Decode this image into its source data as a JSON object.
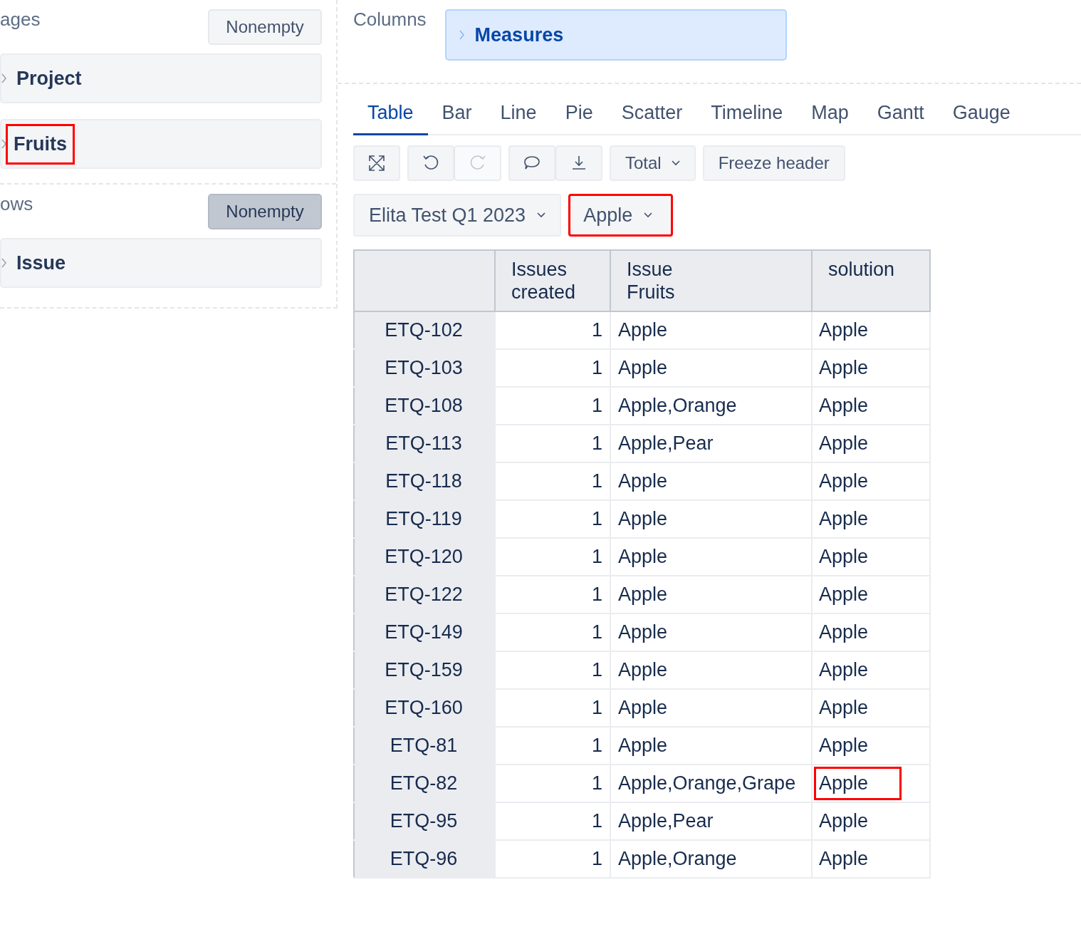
{
  "sections": [
    {
      "title": "ages",
      "nonempty": {
        "label": "Nonempty",
        "selected": false
      },
      "items": [
        {
          "label": "Project",
          "highlighted": false
        },
        {
          "label": "Fruits",
          "highlighted": true
        }
      ]
    },
    {
      "title": "ows",
      "nonempty": {
        "label": "Nonempty",
        "selected": true
      },
      "items": [
        {
          "label": "Issue",
          "highlighted": false
        }
      ]
    }
  ],
  "columns": {
    "title": "Columns",
    "items": [
      {
        "label": "Measures"
      }
    ]
  },
  "tabs": [
    {
      "label": "Table",
      "selected": true
    },
    {
      "label": "Bar",
      "selected": false
    },
    {
      "label": "Line",
      "selected": false
    },
    {
      "label": "Pie",
      "selected": false
    },
    {
      "label": "Scatter",
      "selected": false
    },
    {
      "label": "Timeline",
      "selected": false
    },
    {
      "label": "Map",
      "selected": false
    },
    {
      "label": "Gantt",
      "selected": false
    },
    {
      "label": "Gauge",
      "selected": false
    }
  ],
  "toolbar": {
    "total": "Total",
    "freeze": "Freeze header",
    "redo_disabled": true
  },
  "filters": [
    {
      "label": "Elita Test Q1 2023",
      "highlighted": false
    },
    {
      "label": "Apple",
      "highlighted": true
    }
  ],
  "table": {
    "columns": [
      "Issues\ncreated",
      "Issue\nFruits",
      "solution"
    ],
    "rows": [
      {
        "label": "ETQ-102",
        "issues_created": "1",
        "fruits": "Apple",
        "solution": "Apple",
        "solution_highlighted": false
      },
      {
        "label": "ETQ-103",
        "issues_created": "1",
        "fruits": "Apple",
        "solution": "Apple",
        "solution_highlighted": false
      },
      {
        "label": "ETQ-108",
        "issues_created": "1",
        "fruits": "Apple,Orange",
        "solution": "Apple",
        "solution_highlighted": false
      },
      {
        "label": "ETQ-113",
        "issues_created": "1",
        "fruits": "Apple,Pear",
        "solution": "Apple",
        "solution_highlighted": false
      },
      {
        "label": "ETQ-118",
        "issues_created": "1",
        "fruits": "Apple",
        "solution": "Apple",
        "solution_highlighted": false
      },
      {
        "label": "ETQ-119",
        "issues_created": "1",
        "fruits": "Apple",
        "solution": "Apple",
        "solution_highlighted": false
      },
      {
        "label": "ETQ-120",
        "issues_created": "1",
        "fruits": "Apple",
        "solution": "Apple",
        "solution_highlighted": false
      },
      {
        "label": "ETQ-122",
        "issues_created": "1",
        "fruits": "Apple",
        "solution": "Apple",
        "solution_highlighted": false
      },
      {
        "label": "ETQ-149",
        "issues_created": "1",
        "fruits": "Apple",
        "solution": "Apple",
        "solution_highlighted": false
      },
      {
        "label": "ETQ-159",
        "issues_created": "1",
        "fruits": "Apple",
        "solution": "Apple",
        "solution_highlighted": false
      },
      {
        "label": "ETQ-160",
        "issues_created": "1",
        "fruits": "Apple",
        "solution": "Apple",
        "solution_highlighted": false
      },
      {
        "label": "ETQ-81",
        "issues_created": "1",
        "fruits": "Apple",
        "solution": "Apple",
        "solution_highlighted": false
      },
      {
        "label": "ETQ-82",
        "issues_created": "1",
        "fruits": "Apple,Orange,Grape",
        "solution": "Apple",
        "solution_highlighted": true
      },
      {
        "label": "ETQ-95",
        "issues_created": "1",
        "fruits": "Apple,Pear",
        "solution": "Apple",
        "solution_highlighted": false
      },
      {
        "label": "ETQ-96",
        "issues_created": "1",
        "fruits": "Apple,Orange",
        "solution": "Apple",
        "solution_highlighted": false
      }
    ]
  }
}
